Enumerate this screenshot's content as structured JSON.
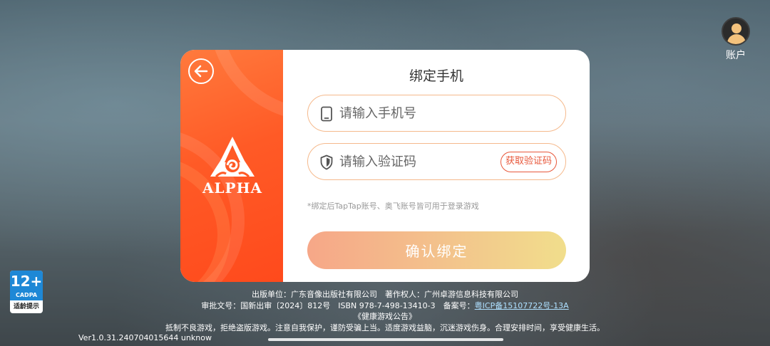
{
  "account": {
    "label": "账户",
    "icon": "user-avatar-icon"
  },
  "rating_badge": {
    "age": "12+",
    "org": "CADPA",
    "note": "适龄提示"
  },
  "brand": {
    "logo_text": "ALPHA",
    "back_icon": "back-arrow-icon"
  },
  "dialog": {
    "title": "绑定手机",
    "phone_placeholder": "请输入手机号",
    "code_placeholder": "请输入验证码",
    "get_code_label": "获取验证码",
    "hint": "*绑定后TapTap账号、奥飞账号皆可用于登录游戏",
    "confirm_label": "确认绑定"
  },
  "footer": {
    "line1": "出版单位：广东音像出版社有限公司　著作权人：广州卓游信息科技有限公司",
    "line2_prefix": "审批文号：国新出审〔2024〕812号　ISBN 978-7-498-13410-3　备案号：",
    "line2_link": "粤ICP备15107722号-13A",
    "line3": "《健康游戏公告》",
    "line4": "抵制不良游戏，拒绝盗版游戏。注意自我保护，谨防受骗上当。适度游戏益脑，沉迷游戏伤身。合理安排时间，享受健康生活。"
  },
  "version": "Ver1.0.31.240704015644 unknow",
  "colors": {
    "accent": "#ff5a26",
    "field_border": "#f5b98c",
    "link": "#aee0ff"
  }
}
